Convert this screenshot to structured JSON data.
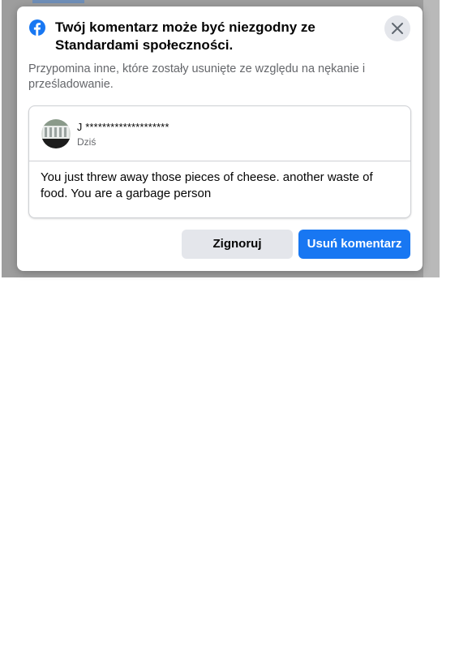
{
  "dialog": {
    "title": "Twój komentarz może być niezgodny ze Standardami społeczności.",
    "subtitle": "Przypomina inne, które zostały usunięte ze względu na nękanie i prześladowanie.",
    "close_icon": "close-icon",
    "logo_icon": "facebook-logo-icon"
  },
  "comment": {
    "author": "J ********************",
    "timestamp": "Dziś",
    "text": "You just threw away those pieces of cheese. another waste of food. You are a garbage person"
  },
  "actions": {
    "ignore_label": "Zignoruj",
    "delete_label": "Usuń komentarz"
  },
  "colors": {
    "primary": "#1877f2",
    "secondary_button": "#e4e6eb",
    "text": "#050505",
    "muted_text": "#65676b"
  }
}
